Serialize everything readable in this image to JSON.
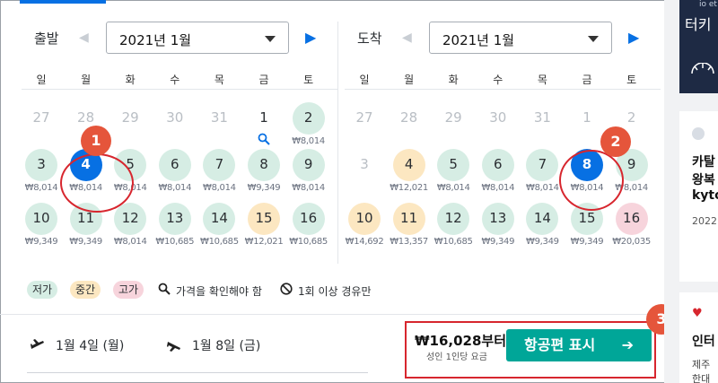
{
  "departure": {
    "label": "출발",
    "month": "2021년 1월",
    "weekdays": [
      "일",
      "월",
      "화",
      "수",
      "목",
      "금",
      "토"
    ],
    "days": [
      {
        "n": "27",
        "state": "muted"
      },
      {
        "n": "28",
        "state": "muted"
      },
      {
        "n": "29",
        "state": "muted"
      },
      {
        "n": "30",
        "state": "muted"
      },
      {
        "n": "31",
        "state": "muted"
      },
      {
        "n": "1",
        "state": "check"
      },
      {
        "n": "2",
        "state": "low",
        "price": "₩8,014"
      },
      {
        "n": "3",
        "state": "low",
        "price": "₩8,014"
      },
      {
        "n": "4",
        "state": "sel",
        "price": "₩8,014"
      },
      {
        "n": "5",
        "state": "low",
        "price": "₩8,014"
      },
      {
        "n": "6",
        "state": "low",
        "price": "₩8,014"
      },
      {
        "n": "7",
        "state": "low",
        "price": "₩8,014"
      },
      {
        "n": "8",
        "state": "low",
        "price": "₩9,349"
      },
      {
        "n": "9",
        "state": "low",
        "price": "₩8,014"
      },
      {
        "n": "10",
        "state": "low",
        "price": "₩9,349"
      },
      {
        "n": "11",
        "state": "low",
        "price": "₩9,349"
      },
      {
        "n": "12",
        "state": "low",
        "price": "₩8,014"
      },
      {
        "n": "13",
        "state": "low",
        "price": "₩10,685"
      },
      {
        "n": "14",
        "state": "low",
        "price": "₩10,685"
      },
      {
        "n": "15",
        "state": "mid",
        "price": "₩12,021"
      },
      {
        "n": "16",
        "state": "low",
        "price": "₩10,685"
      }
    ]
  },
  "arrival": {
    "label": "도착",
    "month": "2021년 1월",
    "weekdays": [
      "일",
      "월",
      "화",
      "수",
      "목",
      "금",
      "토"
    ],
    "days": [
      {
        "n": "27",
        "state": "muted"
      },
      {
        "n": "28",
        "state": "muted"
      },
      {
        "n": "29",
        "state": "muted"
      },
      {
        "n": "30",
        "state": "muted"
      },
      {
        "n": "31",
        "state": "muted"
      },
      {
        "n": "1",
        "state": "muted"
      },
      {
        "n": "2",
        "state": "muted"
      },
      {
        "n": "3",
        "state": "muted"
      },
      {
        "n": "4",
        "state": "mid",
        "price": "₩12,021"
      },
      {
        "n": "5",
        "state": "low",
        "price": "₩8,014"
      },
      {
        "n": "6",
        "state": "low",
        "price": "₩8,014"
      },
      {
        "n": "7",
        "state": "low",
        "price": "₩8,014"
      },
      {
        "n": "8",
        "state": "sel",
        "price": "₩8,014"
      },
      {
        "n": "9",
        "state": "low",
        "price": "₩8,014"
      },
      {
        "n": "10",
        "state": "mid",
        "price": "₩14,692"
      },
      {
        "n": "11",
        "state": "mid",
        "price": "₩13,357"
      },
      {
        "n": "12",
        "state": "low",
        "price": "₩10,685"
      },
      {
        "n": "13",
        "state": "low",
        "price": "₩9,349"
      },
      {
        "n": "14",
        "state": "low",
        "price": "₩9,349"
      },
      {
        "n": "15",
        "state": "low",
        "price": "₩9,349"
      },
      {
        "n": "16",
        "state": "high",
        "price": "₩20,035"
      }
    ]
  },
  "legend": {
    "low": "저가",
    "mid": "중간",
    "high": "고가",
    "check_price": "가격을 확인해야 함",
    "stopover": "1회 이상 경유만"
  },
  "trip": {
    "outbound": "1월 4일 (월)",
    "inbound": "1월 8일 (금)"
  },
  "cta": {
    "price": "₩16,028부터",
    "sub": "성인 1인당 요금",
    "button": "항공편 표시",
    "arrow": "➔"
  },
  "callouts": [
    "1",
    "2",
    "3"
  ],
  "right_column": {
    "banner_title": "터키",
    "banner_small": "io et",
    "card1_lines": [
      "카탈",
      "왕복",
      "kyto",
      "2022"
    ],
    "card2_lines": [
      "인터",
      "제주",
      "한대"
    ]
  },
  "colors": {
    "accent": "#0770e3",
    "low": "#d6ede4",
    "mid": "#fce7c1",
    "high": "#f7d4dc",
    "cta": "#00a698",
    "callout": "#e5553b"
  }
}
